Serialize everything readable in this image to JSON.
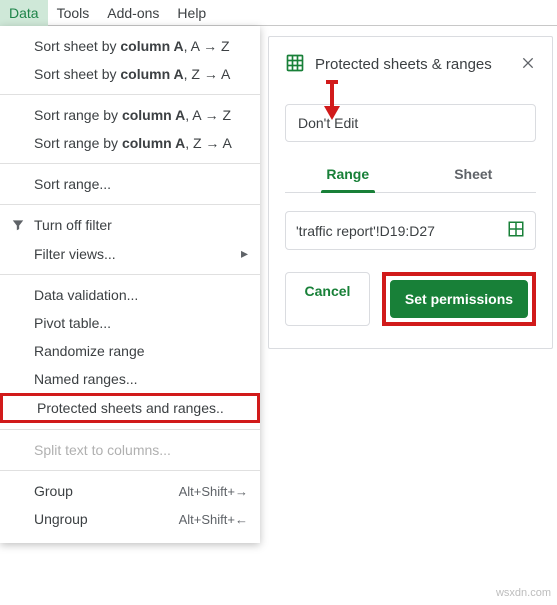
{
  "menubar": {
    "items": [
      "Data",
      "Tools",
      "Add-ons",
      "Help"
    ],
    "activeIndex": 0
  },
  "dropdown": {
    "sort_sheet_az_prefix": "Sort sheet by ",
    "sort_sheet_az_col": "column A",
    "sort_sheet_az_suffix": ", A → Z",
    "sort_sheet_za_prefix": "Sort sheet by ",
    "sort_sheet_za_col": "column A",
    "sort_sheet_za_suffix": ", Z → A",
    "sort_range_az_prefix": "Sort range by ",
    "sort_range_az_col": "column A",
    "sort_range_az_suffix": ", A → Z",
    "sort_range_za_prefix": "Sort range by ",
    "sort_range_za_col": "column A",
    "sort_range_za_suffix": ", Z → A",
    "sort_range": "Sort range...",
    "turn_off_filter": "Turn off filter",
    "filter_views": "Filter views...",
    "data_validation": "Data validation...",
    "pivot_table": "Pivot table...",
    "randomize_range": "Randomize range",
    "named_ranges": "Named ranges...",
    "protected": "Protected sheets and ranges..",
    "split_text": "Split text to columns...",
    "group": "Group",
    "group_shortcut": "Alt+Shift+→",
    "ungroup": "Ungroup",
    "ungroup_shortcut": "Alt+Shift+←"
  },
  "panel": {
    "title": "Protected sheets & ranges",
    "description_value": "Don't Edit",
    "tabs": {
      "range": "Range",
      "sheet": "Sheet"
    },
    "range_value": "'traffic report'!D19:D27",
    "cancel": "Cancel",
    "set_permissions": "Set permissions"
  },
  "watermark": "wsxdn.com"
}
